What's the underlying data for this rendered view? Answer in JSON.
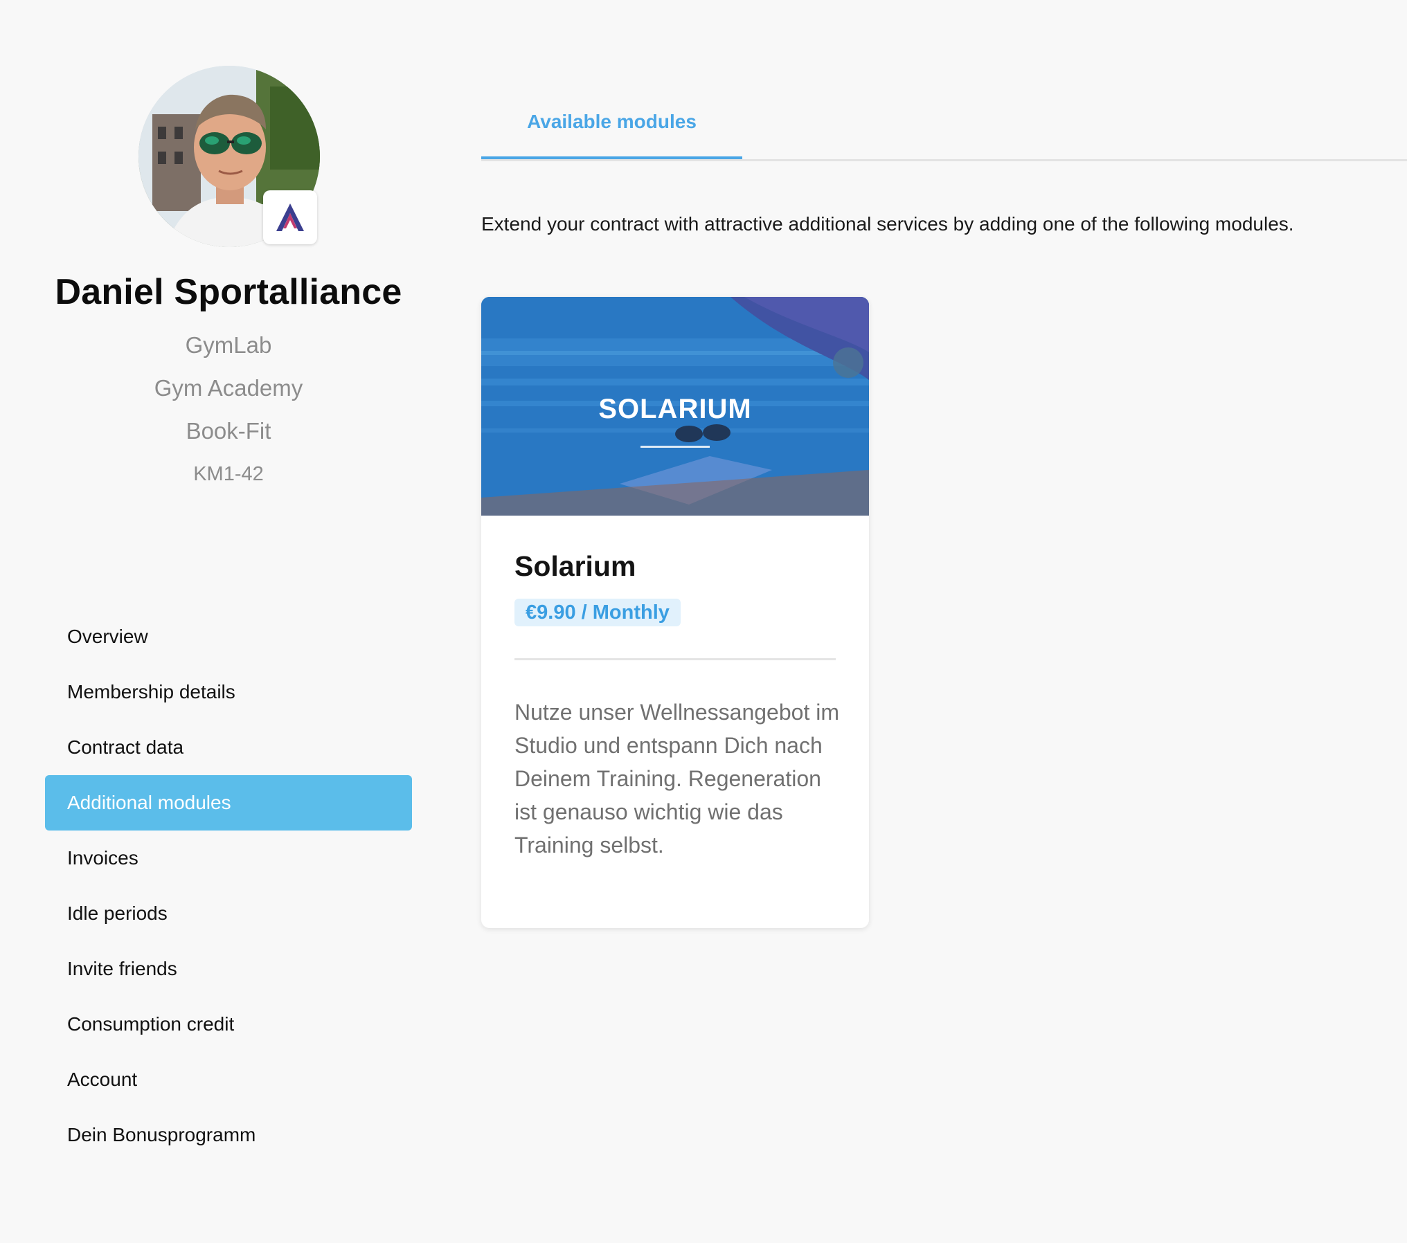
{
  "profile": {
    "name": "Daniel Sportalliance",
    "studio": "GymLab",
    "academy": "Gym Academy",
    "booking": "Book-Fit",
    "member_number": "KM1-42",
    "avatar_icon": "user-photo",
    "brand_icon": "brand-logo-icon"
  },
  "nav": {
    "items": [
      {
        "label": "Overview",
        "active": false
      },
      {
        "label": "Membership details",
        "active": false
      },
      {
        "label": "Contract data",
        "active": false
      },
      {
        "label": "Additional modules",
        "active": true
      },
      {
        "label": "Invoices",
        "active": false
      },
      {
        "label": "Idle periods",
        "active": false
      },
      {
        "label": "Invite friends",
        "active": false
      },
      {
        "label": "Consumption credit",
        "active": false
      },
      {
        "label": "Account",
        "active": false
      },
      {
        "label": "Dein Bonusprogramm",
        "active": false
      }
    ]
  },
  "tabs": [
    {
      "label": "Available modules",
      "active": true
    }
  ],
  "main": {
    "intro": "Extend your contract with attractive additional services by adding one of the following modules."
  },
  "modules": [
    {
      "image_title": "SOLARIUM",
      "title": "Solarium",
      "price": "€9.90 / Monthly",
      "description": "Nutze unser Wellnessangebot im Studio und entspann Dich nach Deinem Training. Regeneration ist genauso wichtig wie das Training selbst."
    }
  ],
  "colors": {
    "accent": "#4aa6e6",
    "active_nav": "#5bbdea",
    "price_bg": "#e1f1fc",
    "background": "#f8f8f8"
  }
}
